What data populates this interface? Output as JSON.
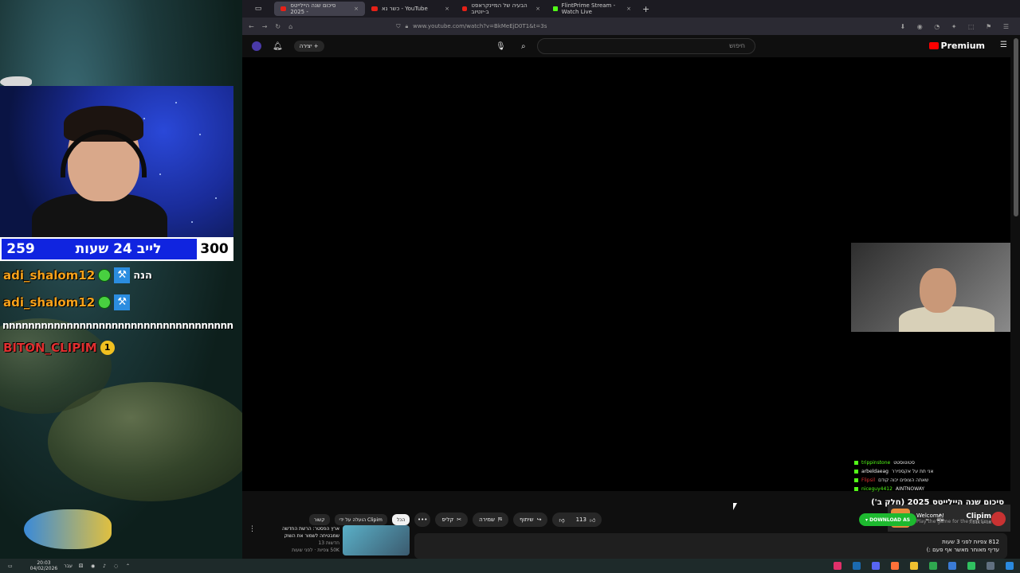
{
  "overlay": {
    "counter": {
      "left_value": "259",
      "title": "לייב 24 שעות",
      "right_value": "300"
    },
    "chat": [
      {
        "user": "adi_shalom12",
        "message": "הנה"
      },
      {
        "user": "adi_shalom12",
        "message": ""
      },
      {
        "user": "BITON_CLIPIM",
        "message": ""
      }
    ],
    "spam_line": "nnnnnnnnnnnnnnnnnnnnnnnnnnnnnnnnnnnn",
    "badge_one": "1"
  },
  "browser": {
    "tabs": [
      {
        "label": "סיכום שנה היילייטס 2025 -",
        "active": true
      },
      {
        "label": "כשר נא - YouTube",
        "active": false
      },
      {
        "label": "הבעיה של המיינקראפט ב-יוטיוב",
        "active": false
      },
      {
        "label": "FlintPrime Stream - Watch Live",
        "active": false
      }
    ],
    "url": "www.youtube.com/watch?v=BkMeEjD0T1&t=3s",
    "new_tab": "+",
    "close": "×"
  },
  "youtube": {
    "create_label": "יצירה",
    "search_placeholder": "חיפוש",
    "premium_label": "Premium",
    "video_title": "סיכום שנה היילייטס 2025 (חלק ב')",
    "channel_name": "Clipim",
    "subscribers": "7.31K מנויים",
    "download_label": "DOWNLOAD AS",
    "likes": "113",
    "share_label": "שיתוף",
    "save_label": "שמירה",
    "clip_label": "קליפ",
    "more_label": "•••",
    "chips": [
      "הכל",
      "הועלה על ידי Clipim",
      "קשור"
    ],
    "description_line1": "812 צפיות  לפני 3 שעות",
    "description_line2": "עדיף מאוחר מאשר אף פעם :)",
    "recommendation": {
      "title": "ארץ הפסטר: הרשת החדשה שמבטיחה לשמור את השוק",
      "channel": "חדשות 13",
      "meta": "50K צפיות · לפני שעות"
    }
  },
  "stream_overlay": {
    "chat": [
      {
        "user": "trippinstone",
        "message": "סטוטוסטט"
      },
      {
        "user": "arbeldaeag",
        "message": "אני תת על אקספירר"
      },
      {
        "user": "Flipsil",
        "message": "שאתה הצופים יכוה קודם"
      },
      {
        "user": "niceguy4412",
        "message": "AINTNOWAY"
      }
    ],
    "welcome_title": "Welcome!",
    "welcome_sub": "Play the game for the first time"
  },
  "taskbar": {
    "time": "20:03",
    "date": "04/02/2026",
    "lang": "עבר"
  },
  "colors": {
    "counter_bg": "#1024e0",
    "username_orange": "#f7a21b",
    "username_red": "#e03030",
    "download_green": "#1db92f",
    "youtube_red": "#ff0000"
  }
}
